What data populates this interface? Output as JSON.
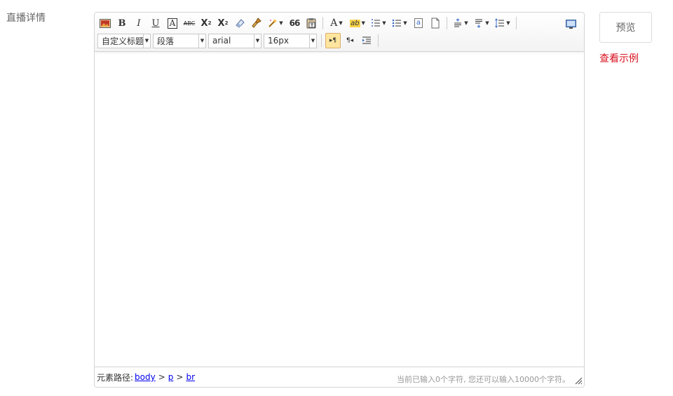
{
  "field_label": "直播详情",
  "toolbar": {
    "combos": {
      "custom_heading": "自定义标题",
      "paragraph": "段落",
      "font_family": "arial",
      "font_size": "16px"
    },
    "glyphs": {
      "bold": "B",
      "italic": "I",
      "underline": "U",
      "border_a": "A",
      "strike": "ABC",
      "superscript": "X",
      "sup_mark": "2",
      "subscript": "X",
      "sub_mark": "2",
      "quote": "66",
      "forecolor": "A",
      "backcolor": "ab",
      "ltr": "▸¶",
      "rtl": "¶◂",
      "anchor": "a"
    }
  },
  "status_bar": {
    "path_label": "元素路径:",
    "path": [
      "body",
      "p",
      "br"
    ],
    "separator": ">",
    "word_count": "当前已输入0个字符, 您还可以输入10000个字符。"
  },
  "preview_button": "预览",
  "example_link": "查看示例",
  "colors": {
    "accent_red": "#d8111e",
    "active_button": "#ffe69f",
    "link_blue": "#0000ee"
  }
}
